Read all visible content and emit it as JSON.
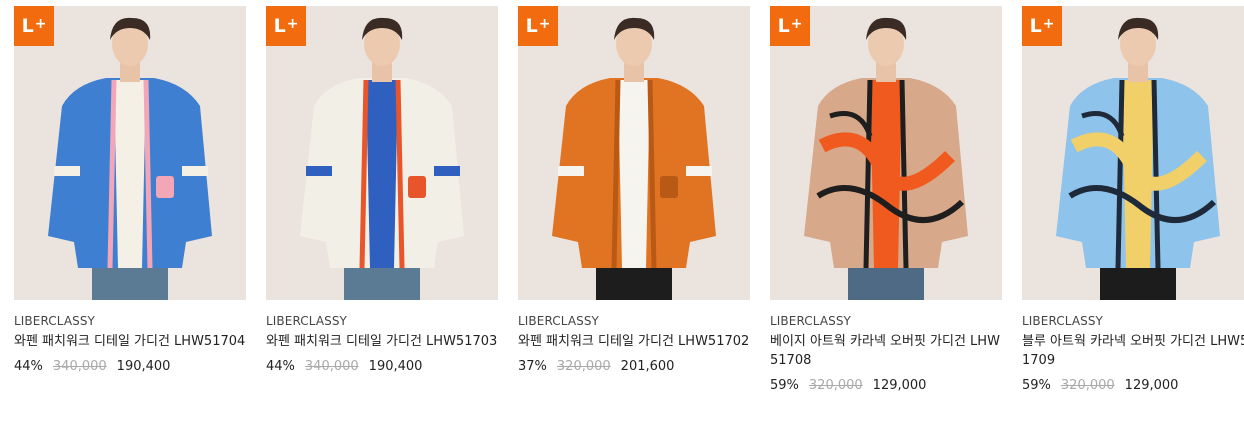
{
  "badge": {
    "text": "L",
    "plus": "+"
  },
  "products": [
    {
      "brand": "LIBERCLASSY",
      "name": "와펜 패치워크 디테일 가디건 LHW51704",
      "discount": "44%",
      "original_price": "340,000",
      "sale_price": "190,400",
      "colors": {
        "bg": "#ebe3dd",
        "main": "#3f7fd1",
        "accent": "#f4f0e6",
        "trim": "#f3a6b8",
        "pants": "#5b7a93"
      }
    },
    {
      "brand": "LIBERCLASSY",
      "name": "와펜 패치워크 디테일 가디건 LHW51703",
      "discount": "44%",
      "original_price": "340,000",
      "sale_price": "190,400",
      "colors": {
        "bg": "#ebe3dd",
        "main": "#f2efe6",
        "accent": "#2f5fbf",
        "trim": "#e8552a",
        "pants": "#5b7a93"
      }
    },
    {
      "brand": "LIBERCLASSY",
      "name": "와펜 패치워크 디테일 가디건 LHW51702",
      "discount": "37%",
      "original_price": "320,000",
      "sale_price": "201,600",
      "colors": {
        "bg": "#ebe3dd",
        "main": "#e07422",
        "accent": "#f6f4ee",
        "trim": "#b85a15",
        "pants": "#1d1d1d"
      }
    },
    {
      "brand": "LIBERCLASSY",
      "name": "베이지 아트웍 카라넥 오버핏 가디건 LHW51708",
      "discount": "59%",
      "original_price": "320,000",
      "sale_price": "129,000",
      "colors": {
        "bg": "#ebe3dd",
        "main": "#d7a88a",
        "accent": "#f15a1e",
        "trim": "#1e1e1e",
        "pants": "#4e6a85"
      }
    },
    {
      "brand": "LIBERCLASSY",
      "name": "블루 아트웍 카라넥 오버핏 가디건 LHW51709",
      "discount": "59%",
      "original_price": "320,000",
      "sale_price": "129,000",
      "colors": {
        "bg": "#ebe3dd",
        "main": "#8ec3ec",
        "accent": "#f1d06a",
        "trim": "#1e2a3a",
        "pants": "#1c1c1c"
      }
    }
  ]
}
